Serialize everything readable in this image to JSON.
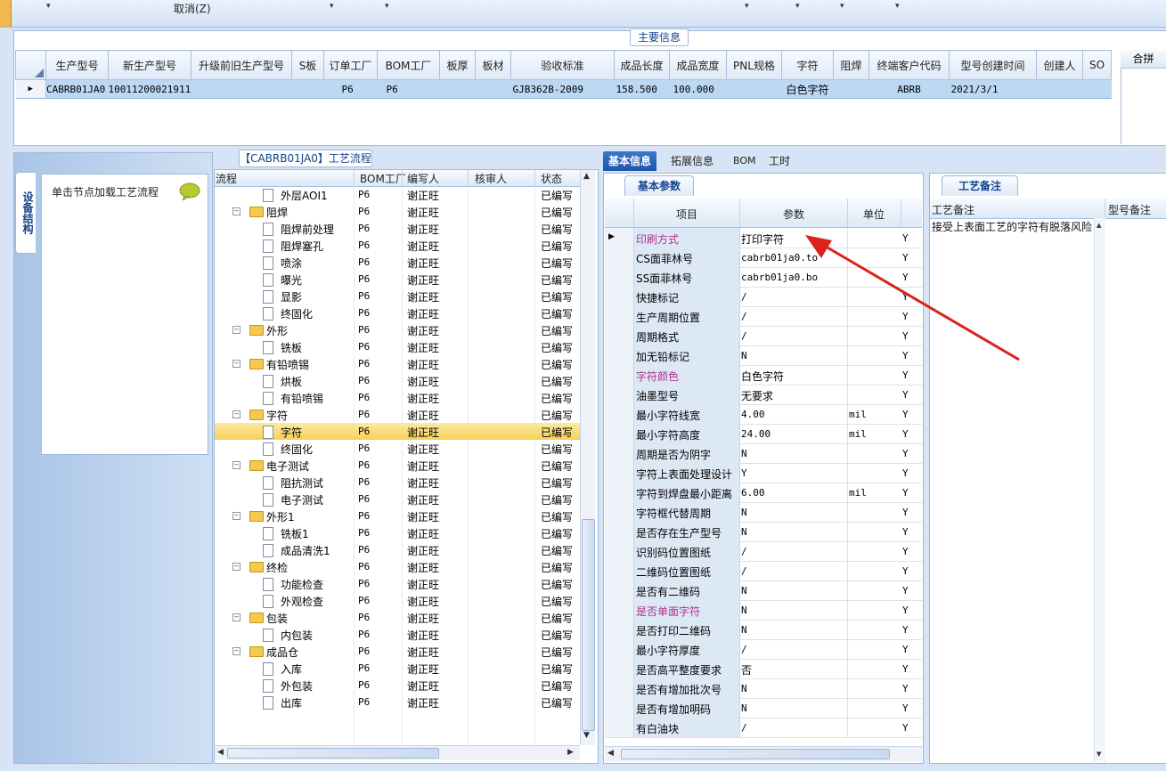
{
  "toolbar": {
    "cancel_label": "取消(Z)"
  },
  "main_info": {
    "title": "主要信息",
    "headers": [
      "生产型号",
      "新生产型号",
      "升级前旧生产型号",
      "S板",
      "订单工厂",
      "BOM工厂",
      "板厚",
      "板材",
      "验收标准",
      "成品长度",
      "成品宽度",
      "PNL规格",
      "字符",
      "阻焊",
      "终端客户代码",
      "型号创建时间",
      "创建人",
      "SO"
    ],
    "row": [
      "CABRB01JA0",
      "10011200021911",
      "",
      "",
      "P6",
      "P6",
      "",
      "",
      "GJB362B-2009",
      "158.500",
      "100.000",
      "",
      "白色字符",
      "",
      "ABRB",
      "2021/3/1",
      "",
      ""
    ],
    "right_header": "合拼"
  },
  "left_panel": {
    "tab_label": "设备结构",
    "load_label": "单击节点加载工艺流程"
  },
  "flow": {
    "title": "【CABRB01JA0】工艺流程",
    "headers": [
      "流程",
      "BOM工厂",
      "编写人",
      "核审人",
      "状态"
    ],
    "rows": [
      {
        "name": "外层AOI1",
        "level": 2,
        "bom": "P6",
        "writer": "谢正旺",
        "reviewer": "",
        "status": "已编写"
      },
      {
        "name": "阻焊",
        "level": 1,
        "bom": "P6",
        "writer": "谢正旺",
        "reviewer": "",
        "status": "已编写"
      },
      {
        "name": "阻焊前处理",
        "level": 2,
        "bom": "P6",
        "writer": "谢正旺",
        "reviewer": "",
        "status": "已编写"
      },
      {
        "name": "阻焊塞孔",
        "level": 2,
        "bom": "P6",
        "writer": "谢正旺",
        "reviewer": "",
        "status": "已编写"
      },
      {
        "name": "喷涂",
        "level": 2,
        "bom": "P6",
        "writer": "谢正旺",
        "reviewer": "",
        "status": "已编写"
      },
      {
        "name": "曝光",
        "level": 2,
        "bom": "P6",
        "writer": "谢正旺",
        "reviewer": "",
        "status": "已编写"
      },
      {
        "name": "显影",
        "level": 2,
        "bom": "P6",
        "writer": "谢正旺",
        "reviewer": "",
        "status": "已编写"
      },
      {
        "name": "终固化",
        "level": 2,
        "bom": "P6",
        "writer": "谢正旺",
        "reviewer": "",
        "status": "已编写"
      },
      {
        "name": "外形",
        "level": 1,
        "bom": "P6",
        "writer": "谢正旺",
        "reviewer": "",
        "status": "已编写"
      },
      {
        "name": "铣板",
        "level": 2,
        "bom": "P6",
        "writer": "谢正旺",
        "reviewer": "",
        "status": "已编写"
      },
      {
        "name": "有铅喷锡",
        "level": 1,
        "bom": "P6",
        "writer": "谢正旺",
        "reviewer": "",
        "status": "已编写"
      },
      {
        "name": "烘板",
        "level": 2,
        "bom": "P6",
        "writer": "谢正旺",
        "reviewer": "",
        "status": "已编写"
      },
      {
        "name": "有铅喷锡",
        "level": 2,
        "bom": "P6",
        "writer": "谢正旺",
        "reviewer": "",
        "status": "已编写"
      },
      {
        "name": "字符",
        "level": 1,
        "bom": "P6",
        "writer": "谢正旺",
        "reviewer": "",
        "status": "已编写"
      },
      {
        "name": "字符",
        "level": 2,
        "bom": "P6",
        "writer": "谢正旺",
        "reviewer": "",
        "status": "已编写",
        "selected": true
      },
      {
        "name": "终固化",
        "level": 2,
        "bom": "P6",
        "writer": "谢正旺",
        "reviewer": "",
        "status": "已编写"
      },
      {
        "name": "电子测试",
        "level": 1,
        "bom": "P6",
        "writer": "谢正旺",
        "reviewer": "",
        "status": "已编写"
      },
      {
        "name": "阻抗测试",
        "level": 2,
        "bom": "P6",
        "writer": "谢正旺",
        "reviewer": "",
        "status": "已编写"
      },
      {
        "name": "电子测试",
        "level": 2,
        "bom": "P6",
        "writer": "谢正旺",
        "reviewer": "",
        "status": "已编写"
      },
      {
        "name": "外形1",
        "level": 1,
        "bom": "P6",
        "writer": "谢正旺",
        "reviewer": "",
        "status": "已编写"
      },
      {
        "name": "铣板1",
        "level": 2,
        "bom": "P6",
        "writer": "谢正旺",
        "reviewer": "",
        "status": "已编写"
      },
      {
        "name": "成品清洗1",
        "level": 2,
        "bom": "P6",
        "writer": "谢正旺",
        "reviewer": "",
        "status": "已编写"
      },
      {
        "name": "终检",
        "level": 1,
        "bom": "P6",
        "writer": "谢正旺",
        "reviewer": "",
        "status": "已编写"
      },
      {
        "name": "功能检查",
        "level": 2,
        "bom": "P6",
        "writer": "谢正旺",
        "reviewer": "",
        "status": "已编写"
      },
      {
        "name": "外观检查",
        "level": 2,
        "bom": "P6",
        "writer": "谢正旺",
        "reviewer": "",
        "status": "已编写"
      },
      {
        "name": "包装",
        "level": 1,
        "bom": "P6",
        "writer": "谢正旺",
        "reviewer": "",
        "status": "已编写"
      },
      {
        "name": "内包装",
        "level": 2,
        "bom": "P6",
        "writer": "谢正旺",
        "reviewer": "",
        "status": "已编写"
      },
      {
        "name": "成品仓",
        "level": 1,
        "bom": "P6",
        "writer": "谢正旺",
        "reviewer": "",
        "status": "已编写"
      },
      {
        "name": "入库",
        "level": 2,
        "bom": "P6",
        "writer": "谢正旺",
        "reviewer": "",
        "status": "已编写"
      },
      {
        "name": "外包装",
        "level": 2,
        "bom": "P6",
        "writer": "谢正旺",
        "reviewer": "",
        "status": "已编写"
      },
      {
        "name": "出库",
        "level": 2,
        "bom": "P6",
        "writer": "谢正旺",
        "reviewer": "",
        "status": "已编写"
      }
    ]
  },
  "right_tabs": [
    "基本信息",
    "拓展信息",
    "BOM",
    "工时"
  ],
  "basic": {
    "subtab": "基本参数",
    "headers": [
      "项目",
      "参数",
      "单位"
    ],
    "rows": [
      {
        "item": "印刷方式",
        "param": "打印字符",
        "unit": "",
        "flag": "Y",
        "magenta": true
      },
      {
        "item": "CS面菲林号",
        "param": "cabrb01ja0.to",
        "unit": "",
        "flag": "Y"
      },
      {
        "item": "SS面菲林号",
        "param": "cabrb01ja0.bo",
        "unit": "",
        "flag": "Y"
      },
      {
        "item": "快捷标记",
        "param": "/",
        "unit": "",
        "flag": "Y"
      },
      {
        "item": "生产周期位置",
        "param": "/",
        "unit": "",
        "flag": "Y"
      },
      {
        "item": "周期格式",
        "param": "/",
        "unit": "",
        "flag": "Y"
      },
      {
        "item": "加无铅标记",
        "param": "N",
        "unit": "",
        "flag": "Y"
      },
      {
        "item": "字符颜色",
        "param": "白色字符",
        "unit": "",
        "flag": "Y",
        "magenta": true
      },
      {
        "item": "油墨型号",
        "param": "无要求",
        "unit": "",
        "flag": "Y"
      },
      {
        "item": "最小字符线宽",
        "param": "4.00",
        "unit": "mil",
        "flag": "Y"
      },
      {
        "item": "最小字符高度",
        "param": "24.00",
        "unit": "mil",
        "flag": "Y"
      },
      {
        "item": "周期是否为阴字",
        "param": "N",
        "unit": "",
        "flag": "Y"
      },
      {
        "item": "字符上表面处理设计",
        "param": "Y",
        "unit": "",
        "flag": "Y"
      },
      {
        "item": "字符到焊盘最小距离",
        "param": "6.00",
        "unit": "mil",
        "flag": "Y"
      },
      {
        "item": "字符框代替周期",
        "param": "N",
        "unit": "",
        "flag": "Y"
      },
      {
        "item": "是否存在生产型号",
        "param": "N",
        "unit": "",
        "flag": "Y"
      },
      {
        "item": "识别码位置图纸",
        "param": "/",
        "unit": "",
        "flag": "Y"
      },
      {
        "item": "二维码位置图纸",
        "param": "/",
        "unit": "",
        "flag": "Y"
      },
      {
        "item": "是否有二维码",
        "param": "N",
        "unit": "",
        "flag": "Y"
      },
      {
        "item": "是否单面字符",
        "param": "N",
        "unit": "",
        "flag": "Y",
        "magenta": true
      },
      {
        "item": "是否打印二维码",
        "param": "N",
        "unit": "",
        "flag": "Y"
      },
      {
        "item": "最小字符厚度",
        "param": "/",
        "unit": "",
        "flag": "Y"
      },
      {
        "item": "是否高平整度要求",
        "param": "否",
        "unit": "",
        "flag": "Y"
      },
      {
        "item": "是否有增加批次号",
        "param": "N",
        "unit": "",
        "flag": "Y"
      },
      {
        "item": "是否有增加明码",
        "param": "N",
        "unit": "",
        "flag": "Y"
      },
      {
        "item": "有白油块",
        "param": "/",
        "unit": "",
        "flag": "Y"
      }
    ]
  },
  "notes": {
    "subtab": "工艺备注",
    "headers": [
      "工艺备注",
      "型号备注"
    ],
    "text": "接受上表面工艺的字符有脱落风险"
  },
  "colors": {
    "accent": "#1f56a8",
    "selection": "#bcd8f3",
    "highlight": "#f6d15a",
    "magenta": "#b0308a",
    "arrow": "#d9231b"
  }
}
